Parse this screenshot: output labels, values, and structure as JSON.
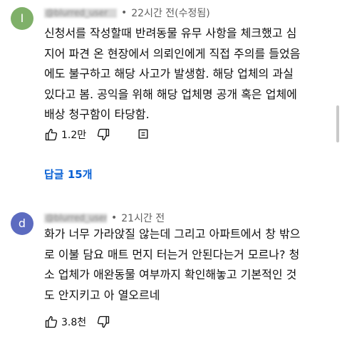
{
  "comments": [
    {
      "avatar_letter": "I",
      "username": "@blurred_user",
      "time": "22시간 전",
      "edited": "(수정됨)",
      "lines": [
        "신청서를 작성할때 반려동물 유무 사항을 체크했고 심",
        "지어 파견 온 현장에서 의뢰인에게 직접 주의를 들었음",
        "에도 불구하고 해당 사고가 발생함. 해당 업체의 과실",
        "있다고 봄. 공익을 위해 해당 업체명 공개 혹은 업체에",
        "배상 청구함이 타당함."
      ],
      "likes": "1.2만",
      "replies_label": "답글 15개"
    },
    {
      "avatar_letter": "d",
      "username": "@blurred_user",
      "time": "21시간 전",
      "lines": [
        "화가 너무 가라앉질 않는데 그리고 아파트에서 창 밖으",
        "로 이불 담요 매트 먼지 터는거 안된다는거 모르나? 청",
        "소 업체가 애완동물 여부까지 확인해놓고 기본적인 것",
        "도 안지키고 아 열오르네"
      ],
      "likes": "3.8천"
    }
  ],
  "icons": {
    "like": "thumbs-up-icon",
    "dislike": "thumbs-down-icon",
    "reply": "reply-icon"
  },
  "colors": {
    "accent": "#065fd4",
    "avatar_1": "#7fb069",
    "avatar_2": "#5c6bc0"
  }
}
